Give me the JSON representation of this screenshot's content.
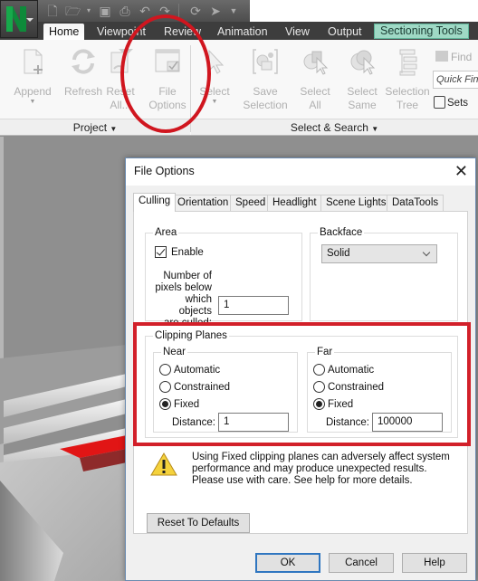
{
  "app": {
    "quick_access_icons": [
      "new-file-icon",
      "open-folder-icon",
      "save-icon",
      "print-icon",
      "undo-icon",
      "redo-icon",
      "refresh-icon",
      "select-cursor-icon",
      "customize-dropdown-icon"
    ]
  },
  "ribbon": {
    "tabs": [
      {
        "label": "Home",
        "active": true
      },
      {
        "label": "Viewpoint"
      },
      {
        "label": "Review"
      },
      {
        "label": "Animation"
      },
      {
        "label": "View"
      },
      {
        "label": "Output"
      },
      {
        "label": "Sectioning Tools",
        "contextual": true
      }
    ],
    "project_group": {
      "label": "Project",
      "buttons": [
        {
          "line1": "Append",
          "line2": "",
          "has_dropdown": true,
          "icon": "append-icon"
        },
        {
          "line1": "Refresh",
          "line2": "",
          "has_dropdown": false,
          "icon": "refresh-icon"
        },
        {
          "line1": "Reset",
          "line2": "All...",
          "has_dropdown": true,
          "icon": "reset-all-icon"
        },
        {
          "line1": "File",
          "line2": "Options",
          "has_dropdown": false,
          "icon": "file-options-icon"
        }
      ]
    },
    "select_group": {
      "label": "Select & Search",
      "buttons": [
        {
          "line1": "Select",
          "line2": "",
          "has_dropdown": true,
          "icon": "select-cursor-icon"
        },
        {
          "line1": "Save",
          "line2": "Selection",
          "has_dropdown": false,
          "icon": "save-selection-icon"
        },
        {
          "line1": "Select",
          "line2": "All",
          "has_dropdown": true,
          "icon": "select-all-icon"
        },
        {
          "line1": "Select",
          "line2": "Same",
          "has_dropdown": true,
          "icon": "select-same-icon"
        },
        {
          "line1": "Selection",
          "line2": "Tree",
          "has_dropdown": false,
          "icon": "selection-tree-icon"
        }
      ],
      "find_label": "Find",
      "quick_find_placeholder": "Quick Find",
      "sets_label": "Sets"
    }
  },
  "dialog": {
    "title": "File Options",
    "close_symbol": "✕",
    "tabs": [
      "Culling",
      "Orientation",
      "Speed",
      "Headlight",
      "Scene Lights",
      "DataTools"
    ],
    "active_tab": "Culling",
    "area": {
      "legend": "Area",
      "enable_label": "Enable",
      "enable_checked": true,
      "pixels_label_lines": [
        "Number of",
        "pixels below",
        "which objects",
        "are culled:"
      ],
      "pixels_value": "1"
    },
    "backface": {
      "legend": "Backface",
      "selected": "Solid"
    },
    "clipping_planes": {
      "legend": "Clipping Planes",
      "near": {
        "legend": "Near",
        "options": [
          "Automatic",
          "Constrained",
          "Fixed"
        ],
        "selected": "Fixed",
        "distance_label": "Distance:",
        "distance_value": "1"
      },
      "far": {
        "legend": "Far",
        "options": [
          "Automatic",
          "Constrained",
          "Fixed"
        ],
        "selected": "Fixed",
        "distance_label": "Distance:",
        "distance_value": "100000"
      }
    },
    "warning": {
      "lines": [
        "Using Fixed clipping planes can adversely affect system",
        "performance and may produce unexpected results.",
        "Please use with care. See help for more details."
      ]
    },
    "reset_label": "Reset To Defaults",
    "ok_label": "OK",
    "cancel_label": "Cancel",
    "help_label": "Help"
  },
  "annotations": {
    "circle_color": "#d0161f",
    "box_color": "#d2202a"
  }
}
